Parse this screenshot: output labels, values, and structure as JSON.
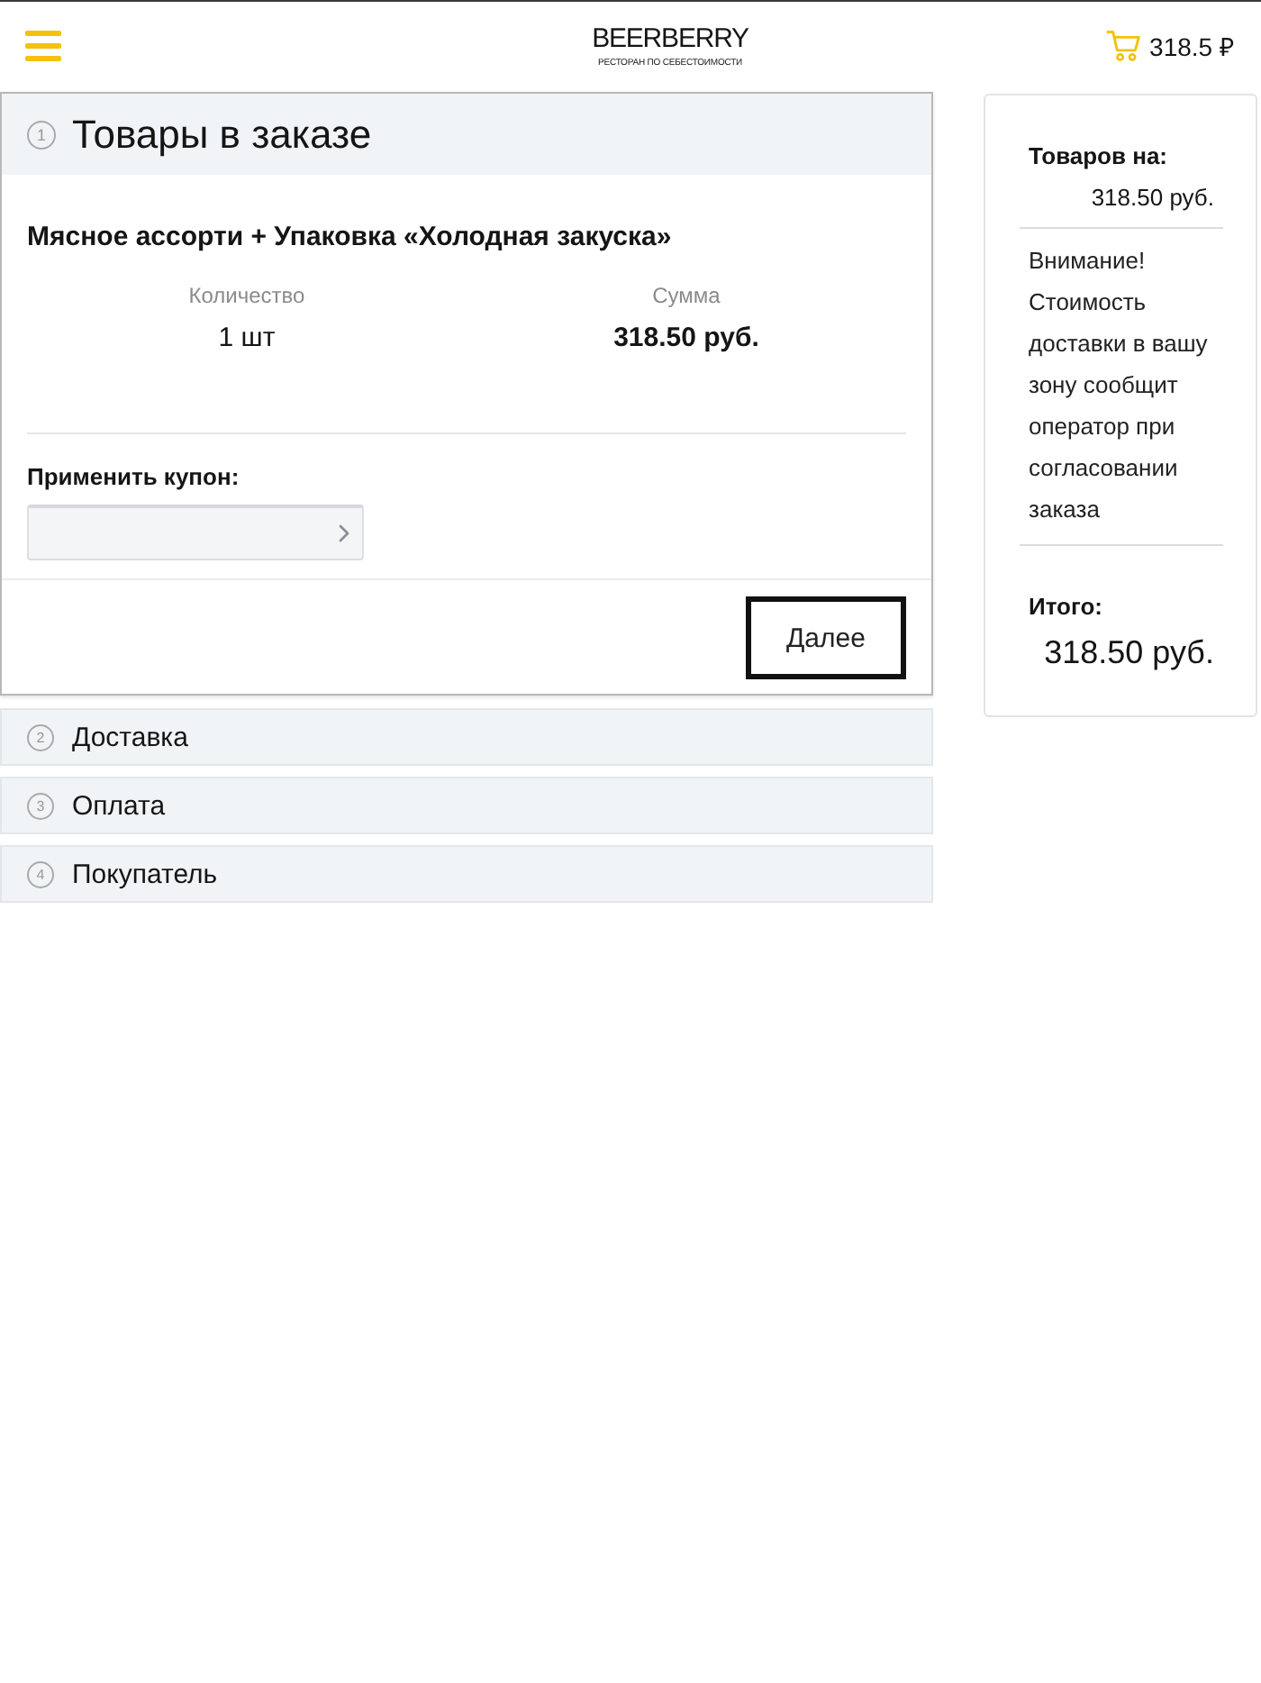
{
  "header": {
    "logo": {
      "name": "BEERBERRY",
      "tagline": "РЕСТОРАН ПО СЕБЕСТОИМОСТИ"
    },
    "cart_total": "318.5 ₽"
  },
  "steps": [
    {
      "number": "1",
      "title": "Товары в заказе",
      "expanded": true
    },
    {
      "number": "2",
      "title": "Доставка",
      "expanded": false
    },
    {
      "number": "3",
      "title": "Оплата",
      "expanded": false
    },
    {
      "number": "4",
      "title": "Покупатель",
      "expanded": false
    }
  ],
  "order": {
    "items": [
      {
        "name": "Мясное ассорти + Упаковка «Холодная закуска»",
        "quantity_label": "Количество",
        "quantity": "1 шт",
        "sum_label": "Сумма",
        "sum": "318.50 руб."
      }
    ],
    "coupon": {
      "label": "Применить купон:"
    },
    "next_button": "Далее"
  },
  "summary": {
    "goods_label": "Товаров на:",
    "goods_total": "318.50 руб.",
    "notice": "Внимание! Стоимость доставки в вашу зону сообщит оператор при согласовании заказа",
    "total_label": "Итого:",
    "total": "318.50 руб."
  }
}
